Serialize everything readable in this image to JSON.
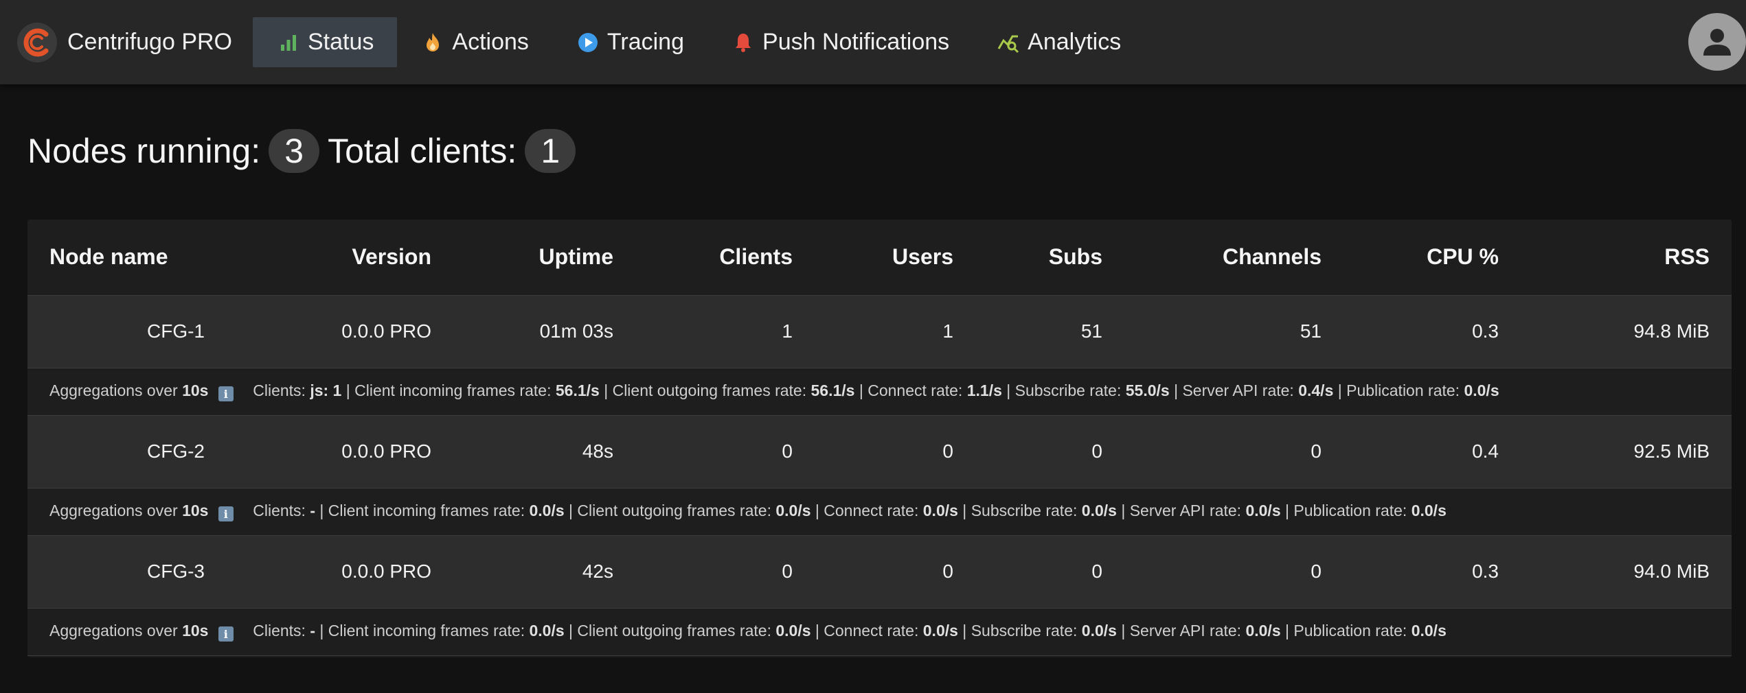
{
  "app": {
    "title": "Centrifugo PRO"
  },
  "nav": {
    "status": "Status",
    "actions": "Actions",
    "tracing": "Tracing",
    "push": "Push Notifications",
    "analytics": "Analytics"
  },
  "colors": {
    "status_icon": "#5fb35f",
    "actions_icon": "#f0a23b",
    "tracing_icon": "#3d9be9",
    "push_icon": "#e44b3c",
    "analytics_icon": "#a8c94a",
    "logo_ring": "#e2532a"
  },
  "summary": {
    "nodes_label": "Nodes running:",
    "nodes_value": "3",
    "clients_label": "Total clients:",
    "clients_value": "1"
  },
  "table": {
    "columns": [
      "Node name",
      "Version",
      "Uptime",
      "Clients",
      "Users",
      "Subs",
      "Channels",
      "CPU %",
      "RSS"
    ],
    "rows": [
      {
        "name": "CFG-1",
        "version": "0.0.0 PRO",
        "uptime": "01m 03s",
        "clients": "1",
        "users": "1",
        "subs": "51",
        "channels": "51",
        "cpu": "0.3",
        "rss": "94.8 MiB",
        "agg": {
          "prefix": "Aggregations over",
          "window": "10s",
          "clients_label": "Clients:",
          "clients": "js: 1",
          "in_label": "Client incoming frames rate:",
          "in": "56.1/s",
          "out_label": "Client outgoing frames rate:",
          "out": "56.1/s",
          "connect_label": "Connect rate:",
          "connect": "1.1/s",
          "subscribe_label": "Subscribe rate:",
          "subscribe": "55.0/s",
          "api_label": "Server API rate:",
          "api": "0.4/s",
          "pub_label": "Publication rate:",
          "pub": "0.0/s"
        }
      },
      {
        "name": "CFG-2",
        "version": "0.0.0 PRO",
        "uptime": "48s",
        "clients": "0",
        "users": "0",
        "subs": "0",
        "channels": "0",
        "cpu": "0.4",
        "rss": "92.5 MiB",
        "agg": {
          "prefix": "Aggregations over",
          "window": "10s",
          "clients_label": "Clients:",
          "clients": "-",
          "in_label": "Client incoming frames rate:",
          "in": "0.0/s",
          "out_label": "Client outgoing frames rate:",
          "out": "0.0/s",
          "connect_label": "Connect rate:",
          "connect": "0.0/s",
          "subscribe_label": "Subscribe rate:",
          "subscribe": "0.0/s",
          "api_label": "Server API rate:",
          "api": "0.0/s",
          "pub_label": "Publication rate:",
          "pub": "0.0/s"
        }
      },
      {
        "name": "CFG-3",
        "version": "0.0.0 PRO",
        "uptime": "42s",
        "clients": "0",
        "users": "0",
        "subs": "0",
        "channels": "0",
        "cpu": "0.3",
        "rss": "94.0 MiB",
        "agg": {
          "prefix": "Aggregations over",
          "window": "10s",
          "clients_label": "Clients:",
          "clients": "-",
          "in_label": "Client incoming frames rate:",
          "in": "0.0/s",
          "out_label": "Client outgoing frames rate:",
          "out": "0.0/s",
          "connect_label": "Connect rate:",
          "connect": "0.0/s",
          "subscribe_label": "Subscribe rate:",
          "subscribe": "0.0/s",
          "api_label": "Server API rate:",
          "api": "0.0/s",
          "pub_label": "Publication rate:",
          "pub": "0.0/s"
        }
      }
    ]
  }
}
